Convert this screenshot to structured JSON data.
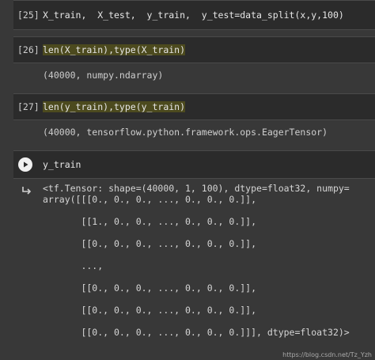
{
  "cells": [
    {
      "prompt": "[25]",
      "code": "X_train,  X_test,  y_train,  y_test=data_split(x,y,100)"
    },
    {
      "prompt": "[26]",
      "code": "len(X_train),type(X_train)",
      "output": "(40000, numpy.ndarray)"
    },
    {
      "prompt": "[27]",
      "code": "len(y_train),type(y_train)",
      "output": "(40000, tensorflow.python.framework.ops.EagerTensor)"
    },
    {
      "code": "y_train"
    }
  ],
  "tensor_output": [
    "<tf.Tensor: shape=(40000, 1, 100), dtype=float32, numpy=",
    "array([[[0., 0., 0., ..., 0., 0., 0.]],",
    "",
    "       [[1., 0., 0., ..., 0., 0., 0.]],",
    "",
    "       [[0., 0., 0., ..., 0., 0., 0.]],",
    "",
    "       ...,",
    "",
    "       [[0., 0., 0., ..., 0., 0., 0.]],",
    "",
    "       [[0., 0., 0., ..., 0., 0., 0.]],",
    "",
    "       [[0., 0., 0., ..., 0., 0., 0.]]], dtype=float32)>"
  ],
  "watermark": "https://blog.csdn.net/Tz_Yzh",
  "icons": {
    "run": "play-icon",
    "output": "output-redirect-icon"
  }
}
